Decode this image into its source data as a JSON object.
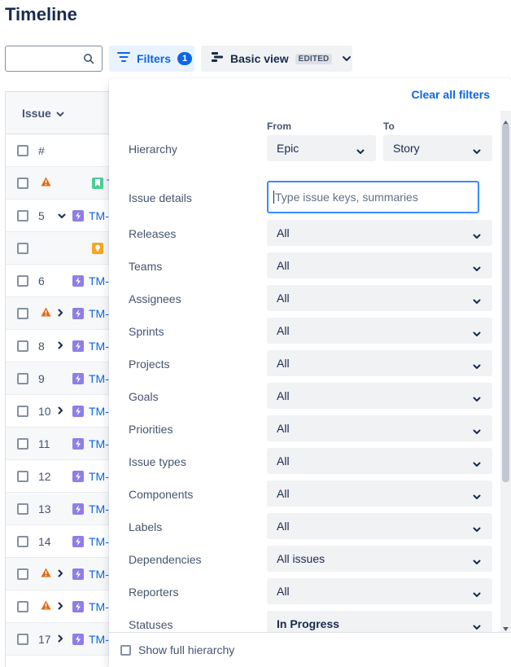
{
  "page": {
    "title": "Timeline"
  },
  "toolbar": {
    "search_placeholder": "",
    "filters_label": "Filters",
    "filters_count": "1",
    "view_label": "Basic view",
    "view_badge": "EDITED"
  },
  "table": {
    "header": "Issue",
    "number_header": "#",
    "rows": [
      {
        "num": "",
        "warning": true,
        "expand": false,
        "icon": "story-icon",
        "key": "T"
      },
      {
        "num": "5",
        "warning": false,
        "expand": true,
        "expanded": true,
        "icon": "epic-icon",
        "key": "TM-"
      },
      {
        "num": "",
        "warning": false,
        "expand": false,
        "icon": "idea-icon",
        "key": ""
      },
      {
        "num": "6",
        "warning": false,
        "expand": false,
        "icon": "epic-icon",
        "key": "TM-"
      },
      {
        "num": "",
        "warning": true,
        "expand": true,
        "icon": "epic-icon",
        "key": "TM-"
      },
      {
        "num": "8",
        "warning": false,
        "expand": true,
        "icon": "epic-icon",
        "key": "TM-"
      },
      {
        "num": "9",
        "warning": false,
        "expand": false,
        "icon": "epic-icon",
        "key": "TM-"
      },
      {
        "num": "10",
        "warning": false,
        "expand": true,
        "icon": "epic-icon",
        "key": "TM-"
      },
      {
        "num": "11",
        "warning": false,
        "expand": false,
        "icon": "epic-icon",
        "key": "TM-"
      },
      {
        "num": "12",
        "warning": false,
        "expand": false,
        "icon": "epic-icon",
        "key": "TM-"
      },
      {
        "num": "13",
        "warning": false,
        "expand": false,
        "icon": "epic-icon",
        "key": "TM-"
      },
      {
        "num": "14",
        "warning": false,
        "expand": false,
        "icon": "epic-icon",
        "key": "TM-"
      },
      {
        "num": "",
        "warning": true,
        "expand": true,
        "icon": "epic-icon",
        "key": "TM-"
      },
      {
        "num": "",
        "warning": true,
        "expand": true,
        "icon": "epic-icon",
        "key": "TM-"
      },
      {
        "num": "17",
        "warning": false,
        "expand": true,
        "icon": "epic-icon",
        "key": "TM-"
      }
    ]
  },
  "filters": {
    "clear_all": "Clear all filters",
    "hierarchy": {
      "label": "Hierarchy",
      "from_label": "From",
      "to_label": "To",
      "from_value": "Epic",
      "to_value": "Story"
    },
    "issue_details": {
      "label": "Issue details",
      "placeholder": "Type issue keys, summaries",
      "value": ""
    },
    "rows": [
      {
        "label": "Releases",
        "value": "All",
        "bold": false
      },
      {
        "label": "Teams",
        "value": "All",
        "bold": false
      },
      {
        "label": "Assignees",
        "value": "All",
        "bold": false
      },
      {
        "label": "Sprints",
        "value": "All",
        "bold": false
      },
      {
        "label": "Projects",
        "value": "All",
        "bold": false
      },
      {
        "label": "Goals",
        "value": "All",
        "bold": false
      },
      {
        "label": "Priorities",
        "value": "All",
        "bold": false
      },
      {
        "label": "Issue types",
        "value": "All",
        "bold": false
      },
      {
        "label": "Components",
        "value": "All",
        "bold": false
      },
      {
        "label": "Labels",
        "value": "All",
        "bold": false
      },
      {
        "label": "Dependencies",
        "value": "All issues",
        "bold": false
      },
      {
        "label": "Reporters",
        "value": "All",
        "bold": false
      },
      {
        "label": "Statuses",
        "value": "In Progress",
        "bold": true
      }
    ],
    "show_full_hierarchy": "Show full hierarchy"
  },
  "colors": {
    "accent": "#0c66e4",
    "epic": "#8f7ee7",
    "warning": "#e56910"
  }
}
